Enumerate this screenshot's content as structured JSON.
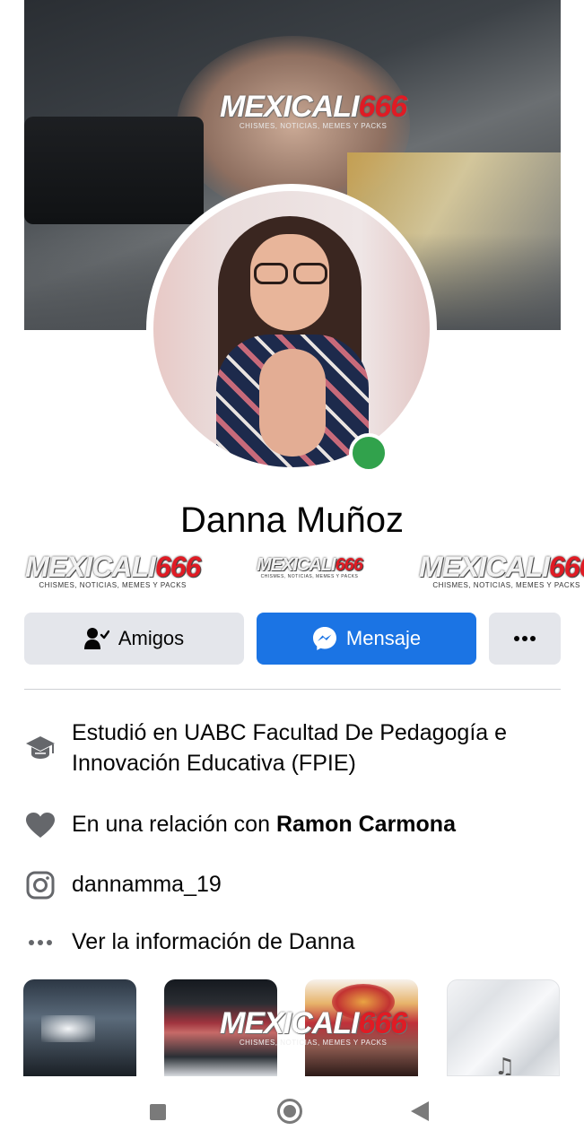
{
  "profile": {
    "name": "Danna Muñoz",
    "online": true,
    "online_color": "#31a24c"
  },
  "watermark": {
    "main_left": "MEXICALI",
    "main_right": "666",
    "sub": "CHISMES, NOTICIAS, MEMES Y PACKS"
  },
  "actions": {
    "friends_label": "Amigos",
    "message_label": "Mensaje",
    "more_label": "•••"
  },
  "details": {
    "education": "Estudió en UABC Facultad De Pedagogía e Innovación Educativa (FPIE)",
    "relationship_prefix": "En una relación con ",
    "relationship_partner": "Ramon Carmona",
    "instagram": "dannamma_19",
    "see_info": "Ver la información de Danna"
  },
  "icons": {
    "education": "graduation-cap-icon",
    "relationship": "heart-icon",
    "instagram": "instagram-icon",
    "more": "more-dots-icon",
    "friends": "friend-check-icon",
    "messenger": "messenger-icon"
  },
  "colors": {
    "primary_blue": "#1b74e4",
    "button_gray": "#e4e6eb",
    "icon_gray": "#65676b",
    "watermark_red": "#e01b24"
  }
}
